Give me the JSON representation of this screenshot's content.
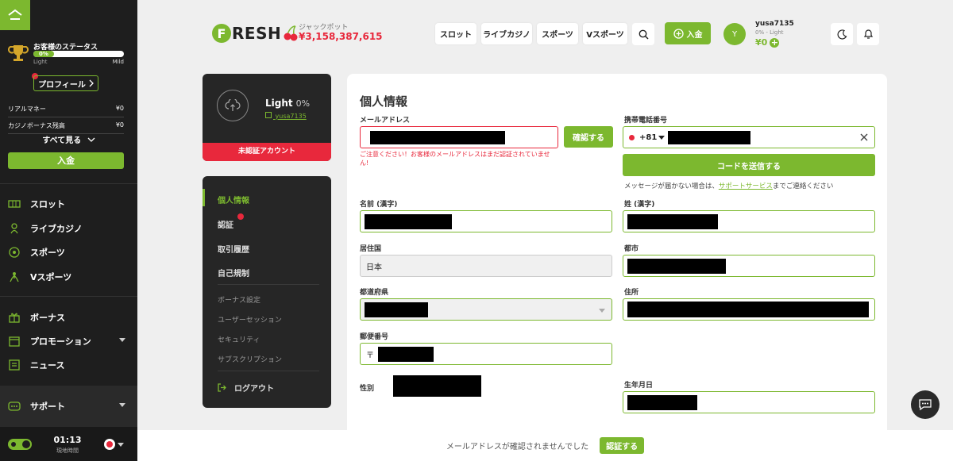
{
  "sidebar": {
    "status_title": "お客様のステータス",
    "status_percent": "0%",
    "status_progress": 0,
    "level_current": "Light",
    "level_next": "Mild",
    "profile_label": "プロフィール",
    "real_money_label": "リアルマネー",
    "real_money_value": "¥0",
    "bonus_label": "カジノボーナス残高",
    "bonus_value": "¥0",
    "see_all_label": "すべて見る",
    "deposit_label": "入金",
    "nav": [
      {
        "label": "スロット",
        "icon": "slot-icon"
      },
      {
        "label": "ライブカジノ",
        "icon": "live-casino-icon"
      },
      {
        "label": "スポーツ",
        "icon": "soccer-ball-icon"
      },
      {
        "label": "Vスポーツ",
        "icon": "vsports-icon"
      },
      {
        "label": "ボーナス",
        "icon": "gift-icon"
      },
      {
        "label": "プロモーション",
        "icon": "calendar-icon"
      },
      {
        "label": "ニュース",
        "icon": "news-icon"
      },
      {
        "label": "サポート",
        "icon": "support-icon"
      }
    ],
    "time": "01:13",
    "time_label": "現地時間"
  },
  "header": {
    "logo_f": "F",
    "logo_text": "RESH",
    "jackpot_label": "ジャックポット",
    "jackpot_value": "¥3,158,387,615",
    "nav": [
      "スロット",
      "ライブカジノ",
      "スポーツ",
      "Vスポーツ"
    ],
    "deposit_label": "入金",
    "avatar_letter": "Y",
    "username": "yusa7135",
    "user_level": "0% - Light",
    "balance": "¥0"
  },
  "profile_card": {
    "level": "Light",
    "percent": "0%",
    "username": "yusa7135",
    "unverified": "未認証アカウント"
  },
  "menu": {
    "items": [
      "個人情報",
      "認証",
      "取引履歴",
      "自己規制"
    ],
    "sub_items": [
      "ボーナス設定",
      "ユーザーセッション",
      "セキュリティ",
      "サブスクリプション"
    ],
    "logout": "ログアウト"
  },
  "form": {
    "title": "個人情報",
    "email_label": "メールアドレス",
    "verify_button": "確認する",
    "email_error": "ご注意ください！お客様のメールアドレスはまだ認証されていません!",
    "phone_label": "携帯電話番号",
    "phone_code": "+81",
    "send_code_button": "コードを送信する",
    "sms_note_pre": "メッセージが届かない場合は、",
    "sms_note_link": "サポートサービス",
    "sms_note_post": "までご連絡ください",
    "first_name_label": "名前 (漢字)",
    "last_name_label": "姓 (漢字)",
    "country_label": "居住国",
    "country_value": "日本",
    "city_label": "都市",
    "prefecture_label": "都道府県",
    "address_label": "住所",
    "postal_label": "郵便番号",
    "postal_prefix": "〒",
    "gender_label": "性別",
    "birthdate_label": "生年月日"
  },
  "banner": {
    "text": "メールアドレスが確認されませんでした",
    "button": "認証する"
  },
  "colors": {
    "accent": "#7cb82f",
    "alert": "#e8283c",
    "sidebar_bg": "#1e1e1e",
    "page_bg": "#efefef"
  }
}
